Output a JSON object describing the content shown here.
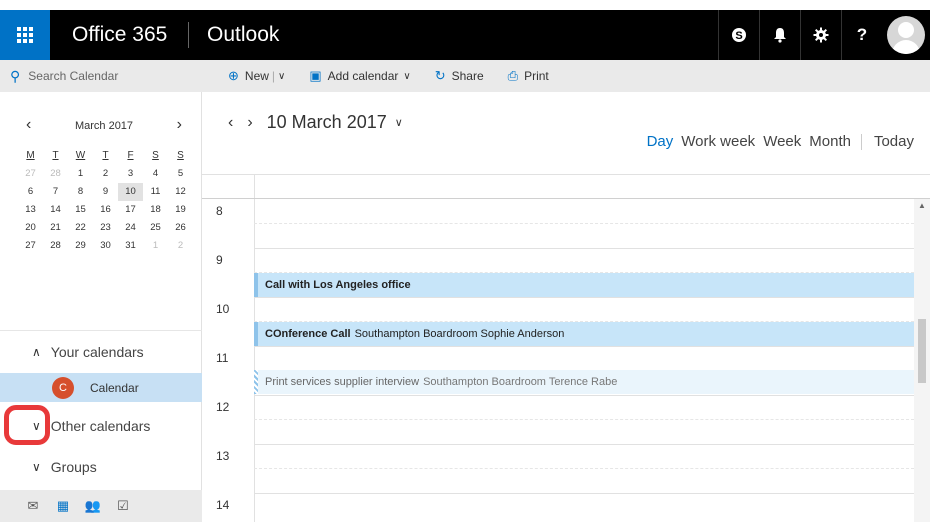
{
  "topbar": {
    "brand": "Office 365",
    "app": "Outlook",
    "icons": [
      "skype-icon",
      "bell-icon",
      "gear-icon",
      "help-icon"
    ],
    "help_label": "?"
  },
  "search": {
    "placeholder": "Search Calendar"
  },
  "toolbar": {
    "new_label": "New",
    "add_calendar_label": "Add calendar",
    "share_label": "Share",
    "print_label": "Print"
  },
  "mini_calendar": {
    "month": "March 2017",
    "weekdays": [
      "M",
      "T",
      "W",
      "T",
      "F",
      "S",
      "S"
    ],
    "weeks": [
      [
        "27",
        "28",
        "1",
        "2",
        "3",
        "4",
        "5"
      ],
      [
        "6",
        "7",
        "8",
        "9",
        "10",
        "11",
        "12"
      ],
      [
        "13",
        "14",
        "15",
        "16",
        "17",
        "18",
        "19"
      ],
      [
        "20",
        "21",
        "22",
        "23",
        "24",
        "25",
        "26"
      ],
      [
        "27",
        "28",
        "29",
        "30",
        "31",
        "1",
        "2"
      ]
    ],
    "selected": "10"
  },
  "sidebar": {
    "your_calendars": "Your calendars",
    "calendar_label": "Calendar",
    "calendar_initial": "C",
    "other_calendars": "Other calendars",
    "groups": "Groups"
  },
  "main": {
    "date": "10 March 2017",
    "views": {
      "day": "Day",
      "work_week": "Work week",
      "week": "Week",
      "month": "Month",
      "today": "Today"
    },
    "hours": [
      "8",
      "9",
      "10",
      "11",
      "12",
      "13",
      "14"
    ],
    "events": [
      {
        "title": "Call with Los Angeles office",
        "detail": ""
      },
      {
        "title": "COnference Call",
        "detail": "Southampton Boardroom Sophie Anderson"
      },
      {
        "title": "Print services supplier interview",
        "detail": "Southampton Boardroom Terence Rabe"
      }
    ]
  },
  "colors": {
    "accent": "#0072c6",
    "event_bg": "#c7e5f9",
    "selected_calendar": "#c7e0f4",
    "calendar_badge": "#d64f2c",
    "highlight": "#e8393a"
  }
}
